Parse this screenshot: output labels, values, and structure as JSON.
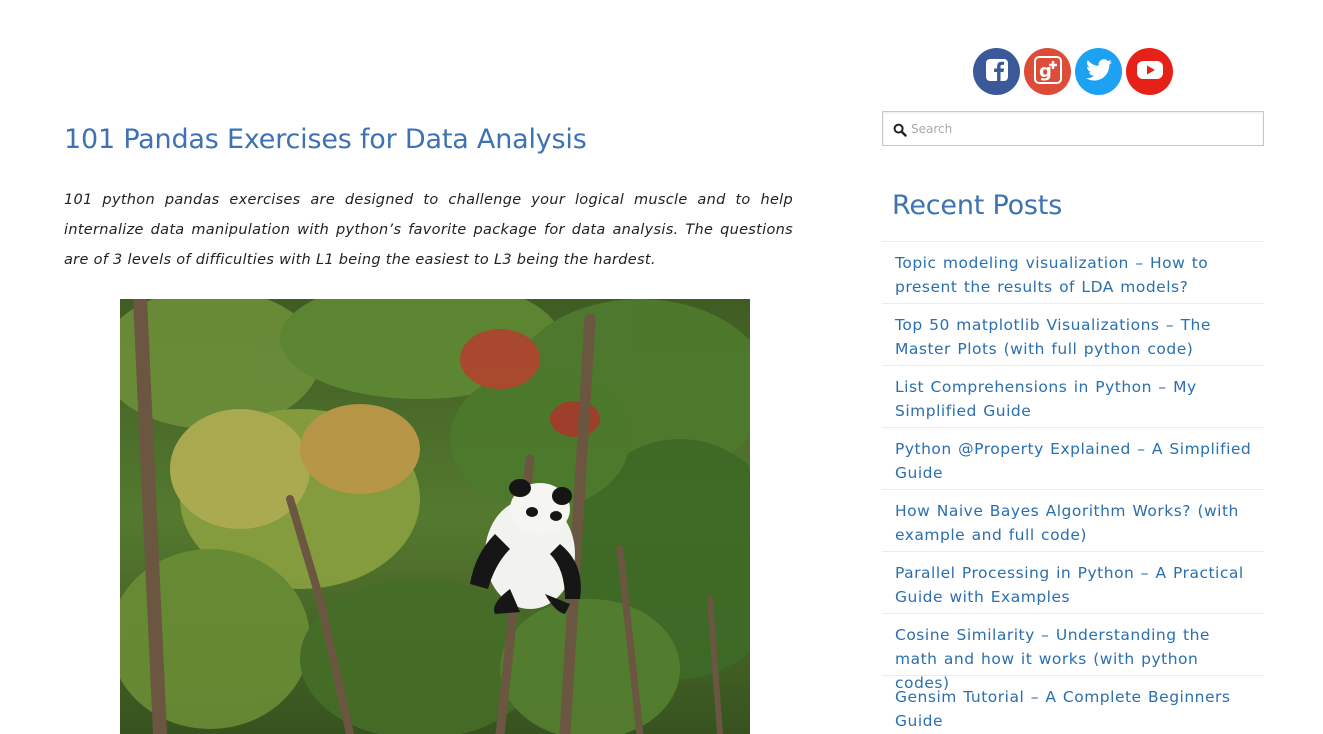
{
  "article": {
    "title": "101 Pandas Exercises for Data Analysis",
    "intro": "101 python pandas exercises are designed to challenge your logical muscle and to help internalize data manipulation with python’s favorite package for data analysis. The questions are of 3 levels of difficulties with L1 being the easiest to L3 being the hardest."
  },
  "social": [
    {
      "name": "facebook",
      "icon": "facebook-icon",
      "color": "#3b5998"
    },
    {
      "name": "google-plus",
      "icon": "google-plus-icon",
      "color": "#dd4b39"
    },
    {
      "name": "twitter",
      "icon": "twitter-icon",
      "color": "#1da1f2"
    },
    {
      "name": "youtube",
      "icon": "youtube-icon",
      "color": "#e62117"
    }
  ],
  "search": {
    "placeholder": "Search",
    "value": ""
  },
  "recent_posts": {
    "title": "Recent Posts",
    "items": [
      {
        "label": "Topic modeling visualization – How to present the results of LDA models?"
      },
      {
        "label": "Top 50 matplotlib Visualizations – The Master Plots (with full python code)"
      },
      {
        "label": "List Comprehensions in Python – My Simplified Guide"
      },
      {
        "label": "Python @Property Explained – A Simplified Guide"
      },
      {
        "label": "How Naive Bayes Algorithm Works? (with example and full code)"
      },
      {
        "label": "Parallel Processing in Python – A Practical Guide with Examples"
      },
      {
        "label": "Cosine Similarity – Understanding the math and how it works (with python codes)"
      },
      {
        "label": "Gensim Tutorial – A Complete Beginners Guide"
      }
    ]
  },
  "colors": {
    "heading": "#3d72b4",
    "link": "#2a6fb0"
  }
}
